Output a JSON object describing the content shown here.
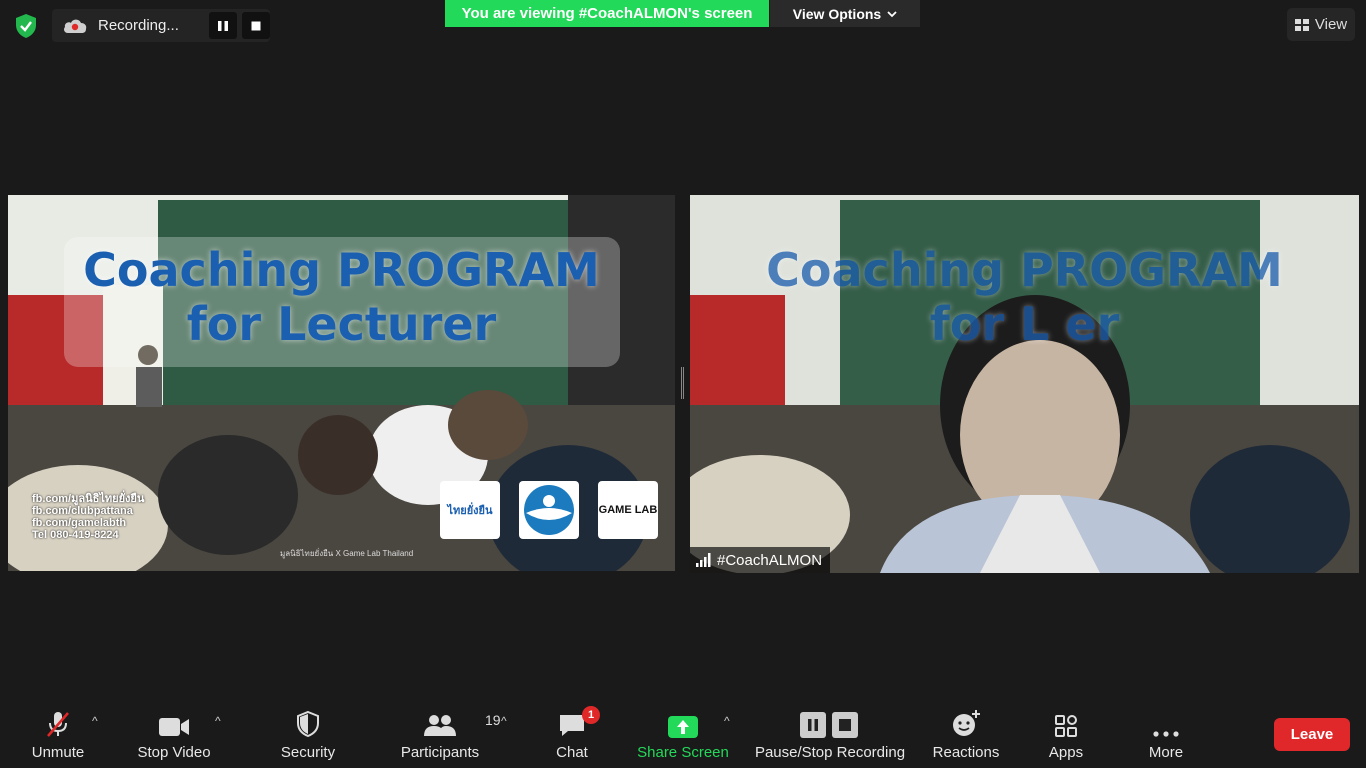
{
  "top_bar": {
    "recording_label": "Recording...",
    "viewing_banner": "You are viewing #CoachALMON's screen",
    "view_options_label": "View Options",
    "view_label": "View"
  },
  "tiles": [
    {
      "slide_title_line1": "Coaching PROGRAM",
      "slide_title_line2": "for Lecturer",
      "contacts": [
        "fb.com/มูลนิธิไทยยั่งยืน",
        "fb.com/clubpattana",
        "fb.com/gamelabth",
        "Tel 080-419-8224"
      ],
      "credit": "มูลนิธิไทยยั่งยืน X Game Lab Thailand",
      "logos": [
        "ไทยยั่งยืน",
        "GAME LAB"
      ]
    },
    {
      "slide_title_line1": "Coaching PROGRAM",
      "slide_title_line2": "for L     er",
      "participant_name": "#CoachALMON"
    }
  ],
  "toolbar": {
    "unmute": "Unmute",
    "stop_video": "Stop Video",
    "security": "Security",
    "participants": "Participants",
    "participants_count": "19",
    "chat": "Chat",
    "chat_badge": "1",
    "share_screen": "Share Screen",
    "pause_stop_recording": "Pause/Stop Recording",
    "reactions": "Reactions",
    "apps": "Apps",
    "more": "More",
    "leave": "Leave"
  },
  "colors": {
    "banner_green": "#23d959",
    "leave_red": "#e0282a",
    "badge_red": "#e02828",
    "share_green": "#23d959",
    "slide_title_blue": "#1b5fb0"
  }
}
